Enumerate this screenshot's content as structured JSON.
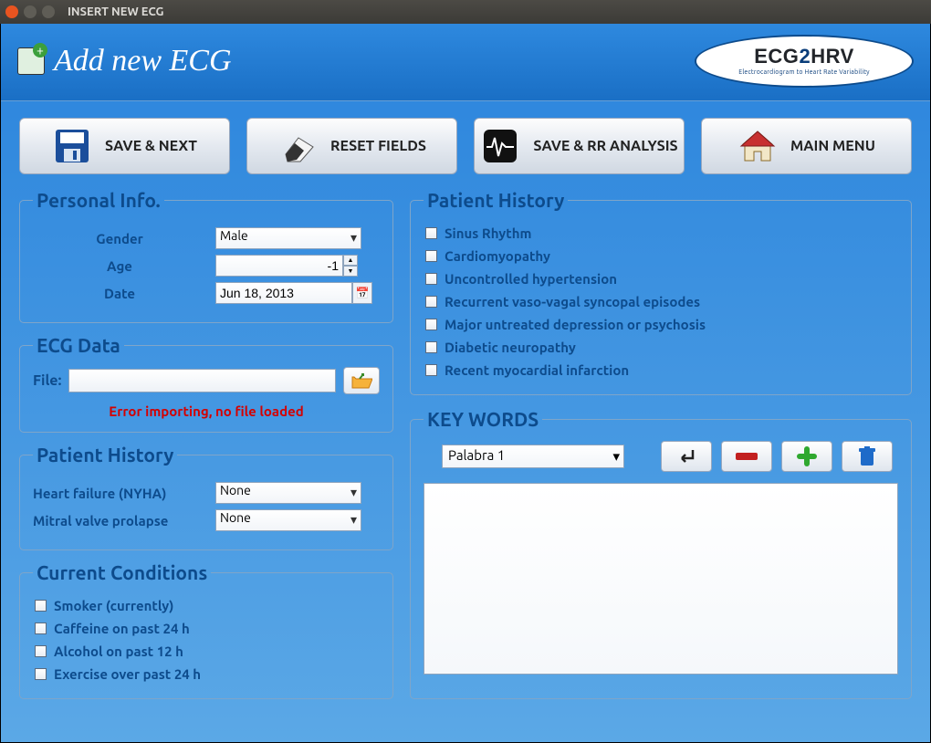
{
  "window": {
    "title": "INSERT NEW ECG"
  },
  "header": {
    "title": "Add new ECG",
    "logo_main": "ECG2HRV",
    "logo_sub": "Electrocardiogram to Heart Rate Variability"
  },
  "toolbar": {
    "save_next": "SAVE & NEXT",
    "reset": "RESET FIELDS",
    "save_rr": "SAVE & RR ANALYSIS",
    "main_menu": "MAIN MENU"
  },
  "personal_info": {
    "legend": "Personal Info.",
    "gender_label": "Gender",
    "gender_value": "Male",
    "age_label": "Age",
    "age_value": "-1",
    "date_label": "Date",
    "date_value": "Jun 18, 2013"
  },
  "ecg_data": {
    "legend": "ECG Data",
    "file_label": "File:",
    "error": "Error importing, no file loaded"
  },
  "patient_history_dd": {
    "legend": "Patient History",
    "hf_label": "Heart failure (NYHA)",
    "hf_value": "None",
    "mvp_label": "Mitral valve prolapse",
    "mvp_value": "None"
  },
  "current_conditions": {
    "legend": "Current Conditions",
    "items": [
      "Smoker (currently)",
      "Caffeine on past 24 h",
      "Alcohol on past 12 h",
      "Exercise over past 24 h"
    ]
  },
  "patient_history_ck": {
    "legend": "Patient History",
    "items": [
      "Sinus Rhythm",
      "Cardiomyopathy",
      "Uncontrolled hypertension",
      "Recurrent vaso-vagal syncopal episodes",
      "Major untreated depression or psychosis",
      "Diabetic neuropathy",
      "Recent myocardial infarction"
    ]
  },
  "keywords": {
    "legend": "KEY WORDS",
    "selected": "Palabra 1"
  }
}
